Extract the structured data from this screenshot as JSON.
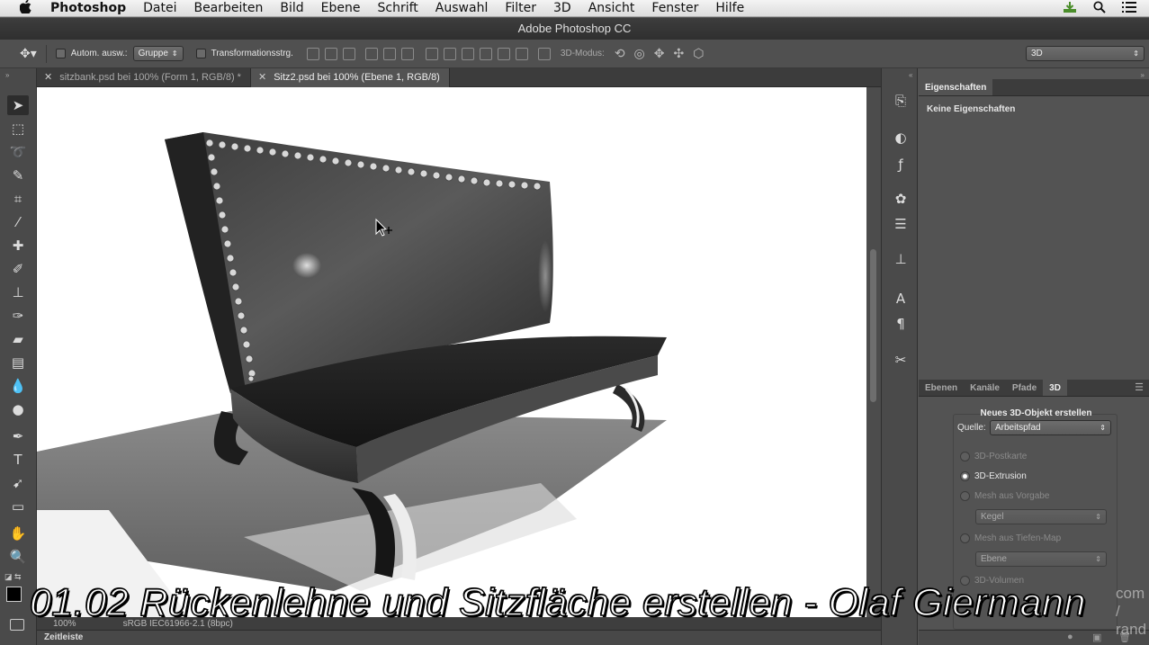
{
  "menubar": {
    "apple": "",
    "items": [
      "Photoshop",
      "Datei",
      "Bearbeiten",
      "Bild",
      "Ebene",
      "Schrift",
      "Auswahl",
      "Filter",
      "3D",
      "Ansicht",
      "Fenster",
      "Hilfe"
    ]
  },
  "window": {
    "title": "Adobe Photoshop CC"
  },
  "options": {
    "auto_select_label": "Autom. ausw.:",
    "auto_select_value": "Gruppe",
    "transform_label": "Transformationsstrg.",
    "mode_3d_label": "3D-Modus:",
    "workspace_value": "3D"
  },
  "tabs": [
    {
      "label": "sitzbank.psd bei 100% (Form 1, RGB/8) *"
    },
    {
      "label": "Sitz2.psd bei 100% (Ebene 1, RGB/8)"
    }
  ],
  "status": {
    "zoom": "100%",
    "profile": "sRGB IEC61966-2.1 (8bpc)"
  },
  "timeline": {
    "label": "Zeitleiste"
  },
  "properties": {
    "tab": "Eigenschaften",
    "empty_text": "Keine Eigenschaften"
  },
  "panel_tabs": [
    "Ebenen",
    "Kanäle",
    "Pfade",
    "3D"
  ],
  "panel_3d": {
    "group_title": "Neues 3D-Objekt erstellen",
    "source_label": "Quelle:",
    "source_value": "Arbeitspfad",
    "options": [
      {
        "label": "3D-Postkarte",
        "selected": false,
        "enabled": false
      },
      {
        "label": "3D-Extrusion",
        "selected": true,
        "enabled": true
      },
      {
        "label": "Mesh aus Vorgabe",
        "selected": false,
        "enabled": false
      },
      {
        "label": "Mesh aus Tiefen-Map",
        "selected": false,
        "enabled": false
      },
      {
        "label": "3D-Volumen",
        "selected": false,
        "enabled": false
      }
    ],
    "mesh_preset_value": "Kegel",
    "depth_map_value": "Ebene"
  },
  "caption": "01.02 Rückenlehne und Sitzfläche erstellen - Olaf Giermann",
  "watermark": "com / rand",
  "colors": {
    "accent": "#535353",
    "toolbar": "#4a4a4a",
    "canvas_bg": "#ffffff"
  }
}
